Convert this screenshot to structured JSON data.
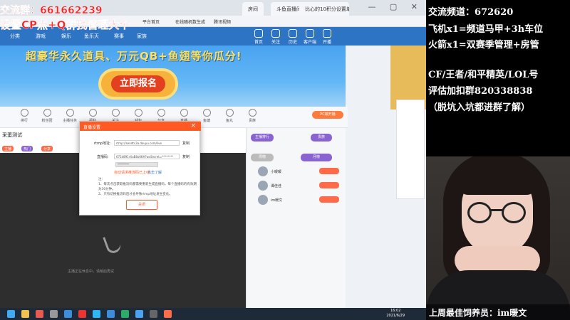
{
  "browser": {
    "tabs": [
      "房间",
      "斗鱼直播间",
      "比心的10积分设置单"
    ],
    "bookmarks": [
      "平台首页",
      "在线随机数生成",
      "腾讯视频"
    ],
    "nav": [
      "分类",
      "游戏",
      "娱乐",
      "鱼乐天",
      "赛事",
      "家族"
    ],
    "header_icons": [
      "首页",
      "关注",
      "历史",
      "客户端",
      "开播"
    ]
  },
  "banner": {
    "title": "超豪华永久道具、万元QB+鱼翅等你瓜分!",
    "signup_label": "立即报名"
  },
  "iconbar": {
    "items": [
      "排行",
      "粉丝团",
      "主播任务",
      "福利",
      "关注",
      "钱包",
      "分享",
      "直播",
      "鱼塘",
      "鱼丸",
      "贵族"
    ],
    "pc_button": "PC端开播"
  },
  "room": {
    "title": "采蛋测试",
    "tags": [
      "主播",
      "热门",
      "分享"
    ]
  },
  "player": {
    "loading_text": "主播正在休息中，请稍后再试"
  },
  "chat": {
    "top_buttons": [
      "主播排行",
      "贵族"
    ],
    "tab_buttons": [
      "周榜",
      "月榜"
    ],
    "ranks": [
      "小暖暖",
      "谭佳佳",
      "im暖文"
    ]
  },
  "modal": {
    "title": "直播设置",
    "close_icon": "×",
    "rtmp_label": "rtmp地址:",
    "rtmp_value": "rtmp://sendtc3a.douyu.com/live",
    "copy_label": "复制",
    "code_label": "直播码:",
    "code_value": "6724891rXaB8o0KH?wsSecret=********",
    "masked_value": "********",
    "reset_text": "自动请求推流码已上线,",
    "help_text": "点击了解",
    "notes_title": "注:",
    "notes": [
      "1、每次点击获取推流码都需要重新生成直播码，每个直播码的有效期为30分钟。",
      "2、只有切换推流码后才会导致rtmp地址发生变化。"
    ],
    "close_button": "关闭"
  },
  "overlay": {
    "qq_line": "交流群：661662239",
    "cp_line": "设置CP点+Q群找管理大个"
  },
  "right_info": {
    "lines": [
      "交流频道：672620",
      "飞机x1=频道马甲+3h车位",
      "火箭x1=双赛季管理+房管",
      "",
      "CF/王者/和平精英/LOL号",
      "评估加扣群820338838",
      "（脱坑入坑都进群了解）"
    ]
  },
  "webcam": {
    "best_fan": "上周最佳饲养员：im暖文"
  },
  "taskbar": {
    "time": "16:02",
    "date": "2021/6/29"
  }
}
